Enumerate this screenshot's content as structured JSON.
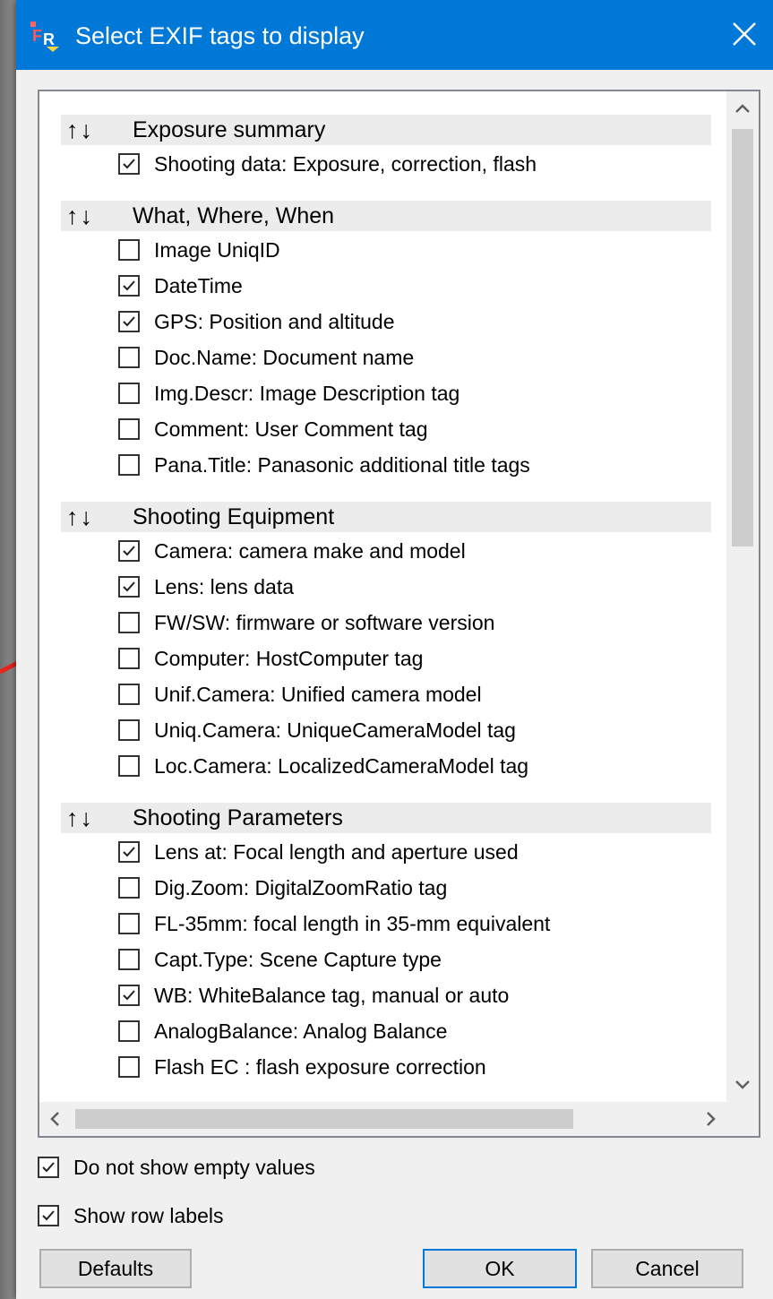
{
  "window": {
    "title": "Select EXIF tags to display",
    "app_icon": "app-logo-icon",
    "close_icon": "close-icon",
    "accent_color": "#0078d7"
  },
  "list": {
    "move_arrows": "↑↓",
    "groups": [
      {
        "title": "Exposure summary",
        "items": [
          {
            "label": "Shooting data: Exposure, correction, flash",
            "checked": true
          }
        ]
      },
      {
        "title": "What, Where, When",
        "items": [
          {
            "label": "Image UniqID",
            "checked": false
          },
          {
            "label": "DateTime",
            "checked": true
          },
          {
            "label": "GPS: Position and altitude",
            "checked": true
          },
          {
            "label": "Doc.Name: Document name",
            "checked": false
          },
          {
            "label": "Img.Descr: Image Description tag",
            "checked": false
          },
          {
            "label": "Comment: User Comment tag",
            "checked": false
          },
          {
            "label": "Pana.Title: Panasonic additional title tags",
            "checked": false
          }
        ]
      },
      {
        "title": "Shooting Equipment",
        "items": [
          {
            "label": "Camera: camera make and model",
            "checked": true
          },
          {
            "label": "Lens: lens data",
            "checked": true
          },
          {
            "label": "FW/SW: firmware or software version",
            "checked": false
          },
          {
            "label": "Computer: HostComputer tag",
            "checked": false
          },
          {
            "label": "Unif.Camera: Unified camera model",
            "checked": false
          },
          {
            "label": "Uniq.Camera: UniqueCameraModel tag",
            "checked": false
          },
          {
            "label": "Loc.Camera: LocalizedCameraModel tag",
            "checked": false
          }
        ]
      },
      {
        "title": "Shooting Parameters",
        "items": [
          {
            "label": "Lens at: Focal length and aperture used",
            "checked": true
          },
          {
            "label": "Dig.Zoom: DigitalZoomRatio tag",
            "checked": false
          },
          {
            "label": "FL-35mm: focal length in 35-mm equivalent",
            "checked": false
          },
          {
            "label": "Capt.Type: Scene Capture type",
            "checked": false
          },
          {
            "label": "WB: WhiteBalance tag, manual or auto",
            "checked": true
          },
          {
            "label": "AnalogBalance: Analog Balance",
            "checked": false
          },
          {
            "label": "Flash EC : flash exposure correction",
            "checked": false
          }
        ]
      }
    ],
    "scroll_up_glyph": "˄",
    "scroll_down_glyph": "˅",
    "scroll_left_glyph": "<",
    "scroll_right_glyph": ">"
  },
  "options": {
    "hide_empty": {
      "label": "Do not show empty values",
      "checked": true
    },
    "row_labels": {
      "label": "Show row labels",
      "checked": true
    }
  },
  "buttons": {
    "defaults": "Defaults",
    "ok": "OK",
    "cancel": "Cancel"
  },
  "annotation": {
    "arrow_color": "#e8231a",
    "points_to": "FW/SW: firmware or software version"
  }
}
